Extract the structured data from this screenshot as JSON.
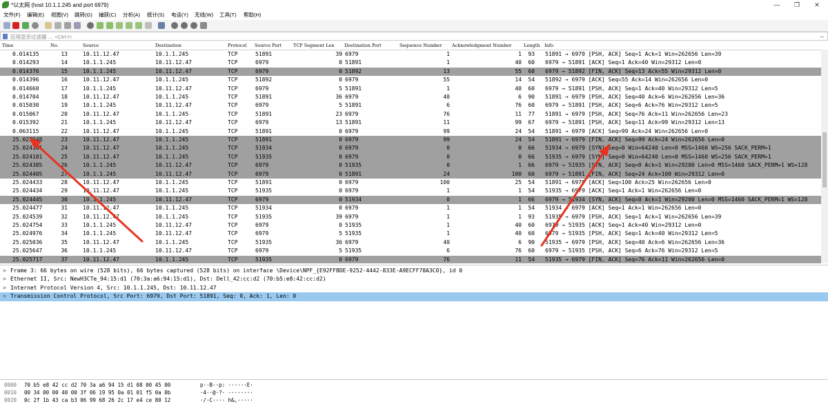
{
  "window": {
    "title": "*以太网 (host  10.1.1.245  and port 6979)",
    "minimize_glyph": "—",
    "maximize_glyph": "❐",
    "close_glyph": "✕"
  },
  "menu": [
    "文件(F)",
    "编辑(E)",
    "视图(V)",
    "跳转(G)",
    "捕获(C)",
    "分析(A)",
    "统计(S)",
    "电话(Y)",
    "无线(W)",
    "工具(T)",
    "帮助(H)"
  ],
  "filter": {
    "placeholder": "应用显示过滤器 … <Ctrl-/>",
    "arrow_glyph": "→"
  },
  "columns": [
    "Time",
    "No.",
    "Source",
    "Destination",
    "Protocol",
    "Source Port",
    "TCP Segment Len",
    "Destination Port",
    "Sequence Number",
    "Acknowledgment Number",
    "Length",
    "Info"
  ],
  "packets": [
    {
      "time": "0.014135",
      "no": "13",
      "src": "10.11.12.47",
      "dst": "10.1.1.245",
      "proto": "TCP",
      "sport": "51891",
      "seglen": "39",
      "dport": "6979",
      "seq": "1",
      "ack": "1",
      "len": "93",
      "info": "51891 → 6979 [PSH, ACK] Seq=1 Ack=1 Win=262656 Len=39",
      "style": "w"
    },
    {
      "time": "0.014293",
      "no": "14",
      "src": "10.1.1.245",
      "dst": "10.11.12.47",
      "proto": "TCP",
      "sport": "6979",
      "seglen": "0",
      "dport": "51891",
      "seq": "1",
      "ack": "40",
      "len": "60",
      "info": "6979 → 51891 [ACK] Seq=1 Ack=40 Win=29312 Len=0",
      "style": "w"
    },
    {
      "time": "0.014376",
      "no": "15",
      "src": "10.1.1.245",
      "dst": "10.11.12.47",
      "proto": "TCP",
      "sport": "6979",
      "seglen": "0",
      "dport": "51892",
      "seq": "13",
      "ack": "55",
      "len": "60",
      "info": "6979 → 51892 [FIN, ACK] Seq=13 Ack=55 Win=29312 Len=0",
      "style": "g"
    },
    {
      "time": "0.014396",
      "no": "16",
      "src": "10.11.12.47",
      "dst": "10.1.1.245",
      "proto": "TCP",
      "sport": "51892",
      "seglen": "0",
      "dport": "6979",
      "seq": "55",
      "ack": "14",
      "len": "54",
      "info": "51892 → 6979 [ACK] Seq=55 Ack=14 Win=262656 Len=0",
      "style": "w"
    },
    {
      "time": "0.014660",
      "no": "17",
      "src": "10.1.1.245",
      "dst": "10.11.12.47",
      "proto": "TCP",
      "sport": "6979",
      "seglen": "5",
      "dport": "51891",
      "seq": "1",
      "ack": "40",
      "len": "60",
      "info": "6979 → 51891 [PSH, ACK] Seq=1 Ack=40 Win=29312 Len=5",
      "style": "w"
    },
    {
      "time": "0.014704",
      "no": "18",
      "src": "10.11.12.47",
      "dst": "10.1.1.245",
      "proto": "TCP",
      "sport": "51891",
      "seglen": "36",
      "dport": "6979",
      "seq": "40",
      "ack": "6",
      "len": "90",
      "info": "51891 → 6979 [PSH, ACK] Seq=40 Ack=6 Win=262656 Len=36",
      "style": "w"
    },
    {
      "time": "0.015030",
      "no": "19",
      "src": "10.1.1.245",
      "dst": "10.11.12.47",
      "proto": "TCP",
      "sport": "6979",
      "seglen": "5",
      "dport": "51891",
      "seq": "6",
      "ack": "76",
      "len": "60",
      "info": "6979 → 51891 [PSH, ACK] Seq=6 Ack=76 Win=29312 Len=5",
      "style": "w"
    },
    {
      "time": "0.015067",
      "no": "20",
      "src": "10.11.12.47",
      "dst": "10.1.1.245",
      "proto": "TCP",
      "sport": "51891",
      "seglen": "23",
      "dport": "6979",
      "seq": "76",
      "ack": "11",
      "len": "77",
      "info": "51891 → 6979 [PSH, ACK] Seq=76 Ack=11 Win=262656 Len=23",
      "style": "w"
    },
    {
      "time": "0.015392",
      "no": "21",
      "src": "10.1.1.245",
      "dst": "10.11.12.47",
      "proto": "TCP",
      "sport": "6979",
      "seglen": "13",
      "dport": "51891",
      "seq": "11",
      "ack": "99",
      "len": "67",
      "info": "6979 → 51891 [PSH, ACK] Seq=11 Ack=99 Win=29312 Len=13",
      "style": "w"
    },
    {
      "time": "0.063115",
      "no": "22",
      "src": "10.11.12.47",
      "dst": "10.1.1.245",
      "proto": "TCP",
      "sport": "51891",
      "seglen": "0",
      "dport": "6979",
      "seq": "99",
      "ack": "24",
      "len": "54",
      "info": "51891 → 6979 [ACK] Seq=99 Ack=24 Win=262656 Len=0",
      "style": "w"
    },
    {
      "time": "25.023948",
      "no": "23",
      "src": "10.11.12.47",
      "dst": "10.1.1.245",
      "proto": "TCP",
      "sport": "51891",
      "seglen": "0",
      "dport": "6979",
      "seq": "99",
      "ack": "24",
      "len": "54",
      "info": "51891 → 6979 [FIN, ACK] Seq=99 Ack=24 Win=262656 Len=0",
      "style": "g"
    },
    {
      "time": "25.024101",
      "no": "24",
      "src": "10.11.12.47",
      "dst": "10.1.1.245",
      "proto": "TCP",
      "sport": "51934",
      "seglen": "0",
      "dport": "6979",
      "seq": "0",
      "ack": "0",
      "len": "66",
      "info": "51934 → 6979 [SYN] Seq=0 Win=64240 Len=0 MSS=1460 WS=256 SACK_PERM=1",
      "style": "g"
    },
    {
      "time": "25.024101",
      "no": "25",
      "src": "10.11.12.47",
      "dst": "10.1.1.245",
      "proto": "TCP",
      "sport": "51935",
      "seglen": "0",
      "dport": "6979",
      "seq": "0",
      "ack": "0",
      "len": "66",
      "info": "51935 → 6979 [SYN] Seq=0 Win=64240 Len=0 MSS=1460 WS=256 SACK_PERM=1",
      "style": "g"
    },
    {
      "time": "25.024385",
      "no": "26",
      "src": "10.1.1.245",
      "dst": "10.11.12.47",
      "proto": "TCP",
      "sport": "6979",
      "seglen": "0",
      "dport": "51935",
      "seq": "0",
      "ack": "1",
      "len": "66",
      "info": "6979 → 51935 [SYN, ACK] Seq=0 Ack=1 Win=29200 Len=0 MSS=1460 SACK_PERM=1 WS=128",
      "style": "g"
    },
    {
      "time": "25.024405",
      "no": "27",
      "src": "10.1.1.245",
      "dst": "10.11.12.47",
      "proto": "TCP",
      "sport": "6979",
      "seglen": "0",
      "dport": "51891",
      "seq": "24",
      "ack": "100",
      "len": "60",
      "info": "6979 → 51891 [FIN, ACK] Seq=24 Ack=100 Win=29312 Len=0",
      "style": "g"
    },
    {
      "time": "25.024433",
      "no": "28",
      "src": "10.11.12.47",
      "dst": "10.1.1.245",
      "proto": "TCP",
      "sport": "51891",
      "seglen": "0",
      "dport": "6979",
      "seq": "100",
      "ack": "25",
      "len": "54",
      "info": "51891 → 6979 [ACK] Seq=100 Ack=25 Win=262656 Len=0",
      "style": "w"
    },
    {
      "time": "25.024434",
      "no": "29",
      "src": "10.11.12.47",
      "dst": "10.1.1.245",
      "proto": "TCP",
      "sport": "51935",
      "seglen": "0",
      "dport": "6979",
      "seq": "1",
      "ack": "1",
      "len": "54",
      "info": "51935 → 6979 [ACK] Seq=1 Ack=1 Win=262656 Len=0",
      "style": "w"
    },
    {
      "time": "25.024445",
      "no": "30",
      "src": "10.1.1.245",
      "dst": "10.11.12.47",
      "proto": "TCP",
      "sport": "6979",
      "seglen": "0",
      "dport": "51934",
      "seq": "0",
      "ack": "1",
      "len": "66",
      "info": "6979 → 51934 [SYN, ACK] Seq=0 Ack=1 Win=29200 Len=0 MSS=1460 SACK_PERM=1 WS=128",
      "style": "g"
    },
    {
      "time": "25.024477",
      "no": "31",
      "src": "10.11.12.47",
      "dst": "10.1.1.245",
      "proto": "TCP",
      "sport": "51934",
      "seglen": "0",
      "dport": "6979",
      "seq": "1",
      "ack": "1",
      "len": "54",
      "info": "51934 → 6979 [ACK] Seq=1 Ack=1 Win=262656 Len=0",
      "style": "w"
    },
    {
      "time": "25.024539",
      "no": "32",
      "src": "10.11.12.47",
      "dst": "10.1.1.245",
      "proto": "TCP",
      "sport": "51935",
      "seglen": "39",
      "dport": "6979",
      "seq": "1",
      "ack": "1",
      "len": "93",
      "info": "51935 → 6979 [PSH, ACK] Seq=1 Ack=1 Win=262656 Len=39",
      "style": "w"
    },
    {
      "time": "25.024754",
      "no": "33",
      "src": "10.1.1.245",
      "dst": "10.11.12.47",
      "proto": "TCP",
      "sport": "6979",
      "seglen": "0",
      "dport": "51935",
      "seq": "1",
      "ack": "40",
      "len": "60",
      "info": "6979 → 51935 [ACK] Seq=1 Ack=40 Win=29312 Len=0",
      "style": "w"
    },
    {
      "time": "25.024976",
      "no": "34",
      "src": "10.1.1.245",
      "dst": "10.11.12.47",
      "proto": "TCP",
      "sport": "6979",
      "seglen": "5",
      "dport": "51935",
      "seq": "1",
      "ack": "40",
      "len": "60",
      "info": "6979 → 51935 [PSH, ACK] Seq=1 Ack=40 Win=29312 Len=5",
      "style": "w"
    },
    {
      "time": "25.025036",
      "no": "35",
      "src": "10.11.12.47",
      "dst": "10.1.1.245",
      "proto": "TCP",
      "sport": "51935",
      "seglen": "36",
      "dport": "6979",
      "seq": "40",
      "ack": "6",
      "len": "90",
      "info": "51935 → 6979 [PSH, ACK] Seq=40 Ack=6 Win=262656 Len=36",
      "style": "w"
    },
    {
      "time": "25.025647",
      "no": "36",
      "src": "10.1.1.245",
      "dst": "10.11.12.47",
      "proto": "TCP",
      "sport": "6979",
      "seglen": "5",
      "dport": "51935",
      "seq": "6",
      "ack": "76",
      "len": "60",
      "info": "6979 → 51935 [PSH, ACK] Seq=6 Ack=76 Win=29312 Len=5",
      "style": "w"
    },
    {
      "time": "25.025717",
      "no": "37",
      "src": "10.11.12.47",
      "dst": "10.1.1.245",
      "proto": "TCP",
      "sport": "51935",
      "seglen": "0",
      "dport": "6979",
      "seq": "76",
      "ack": "11",
      "len": "54",
      "info": "51935 → 6979 [FIN, ACK] Seq=76 Ack=11 Win=262656 Len=0",
      "style": "g"
    }
  ],
  "details": [
    "Frame 3: 66 bytes on wire (528 bits), 66 bytes captured (528 bits) on interface \\Device\\NPF_{E92FFBDE-9252-4442-833E-A9ECFF78A3C0}, id 0",
    "Ethernet II, Src: NewH3CTe_94:15:d1 (70:3a:a6:94:15:d1), Dst: Dell_42:cc:d2 (70:b5:e8:42:cc:d2)",
    "Internet Protocol Version 4, Src: 10.1.1.245, Dst: 10.11.12.47",
    "Transmission Control Protocol, Src Port: 6979, Dst Port: 51891, Seq: 0, Ack: 1, Len: 0"
  ],
  "expand_glyph": ">",
  "bytes": [
    {
      "offset": "0000",
      "hex": "70 b5 e8 42 cc d2 70 3a  a6 94 15 d1 08 00 45 00",
      "ascii": "p··B··p: ······E·"
    },
    {
      "offset": "0010",
      "hex": "00 34 00 00 40 00 3f 06  19 95 0a 01 01 f5 0a 0b",
      "ascii": "·4··@·?· ········"
    },
    {
      "offset": "0020",
      "hex": "0c 2f 1b 43 ca b3 06 99  68 26 2c 17 e4 ce 80 12",
      "ascii": "·/·C···· h&,·····"
    }
  ],
  "colors": {
    "gray_row": "#a0a0a0",
    "selected_detail": "#99c9ef",
    "annotation": "#e8321f"
  }
}
